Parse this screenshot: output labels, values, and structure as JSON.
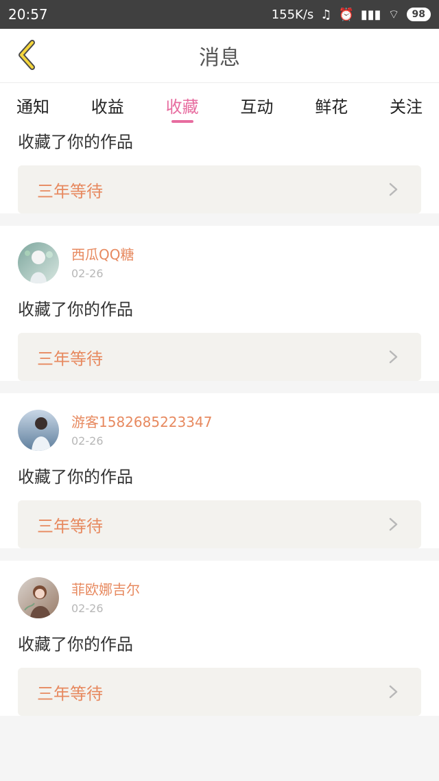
{
  "status": {
    "time": "20:57",
    "speed": "155K/s",
    "battery": "98"
  },
  "header": {
    "title": "消息"
  },
  "tabs": [
    {
      "label": "通知"
    },
    {
      "label": "收益"
    },
    {
      "label": "收藏",
      "active": true
    },
    {
      "label": "互动"
    },
    {
      "label": "鲜花"
    },
    {
      "label": "关注"
    }
  ],
  "items": [
    {
      "action": "收藏了你的作品",
      "work": "三年等待"
    },
    {
      "user": "西瓜QQ糖",
      "date": "02-26",
      "action": "收藏了你的作品",
      "work": "三年等待"
    },
    {
      "user": "游客1582685223347",
      "date": "02-26",
      "action": "收藏了你的作品",
      "work": "三年等待"
    },
    {
      "user": "菲欧娜吉尔",
      "date": "02-26",
      "action": "收藏了你的作品",
      "work": "三年等待"
    }
  ]
}
